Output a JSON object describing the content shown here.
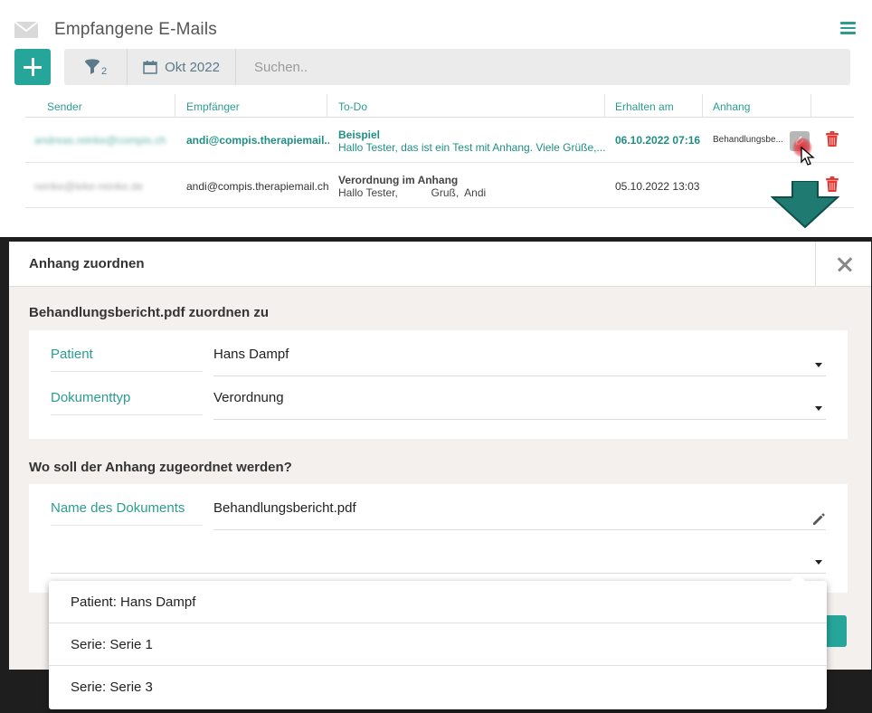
{
  "mail": {
    "title": "Empfangene E-Mails",
    "filter_count": "2",
    "date_filter": "Okt 2022",
    "search_placeholder": "Suchen..",
    "columns": [
      "Sender",
      "Empfänger",
      "To-Do",
      "Erhalten am",
      "Anhang"
    ],
    "rows": [
      {
        "sender": "andreas.reinke@compis.ch",
        "recipient": "andi@compis.therapiemail....",
        "todo_title": "Beispiel",
        "todo_body": "Hallo Tester,  das ist ein Test mit Anhang.  Viele Grüße,...",
        "received": "06.10.2022 07:16",
        "attachment": "Behandlungsbe...",
        "unread": true
      },
      {
        "sender": "reinke@leke-reinke.de",
        "recipient": "andi@compis.therapiemail.ch",
        "todo_title": "Verordnung im Anhang",
        "todo_body": "Hallo Tester,           Gruß,  Andi",
        "received": "05.10.2022 13:03",
        "attachment": "",
        "unread": false
      }
    ]
  },
  "modal": {
    "title": "Anhang zuordnen",
    "section1_title": "Behandlungsbericht.pdf zuordnen zu",
    "patient_label": "Patient",
    "patient_value": "Hans Dampf",
    "doctype_label": "Dokumenttyp",
    "doctype_value": "Verordnung",
    "section2_title": "Wo soll der Anhang zugeordnet werden?",
    "docname_label": "Name des Dokuments",
    "docname_value": "Behandlungsbericht.pdf",
    "target_value": ""
  },
  "dropdown": {
    "options": [
      "Patient: Hans Dampf",
      "Serie: Serie 1",
      "Serie: Serie 3"
    ]
  },
  "colors": {
    "accent": "#26a69a",
    "accent_text": "#2a9d8f",
    "danger": "#e53935",
    "arrow": "#1f7a72"
  }
}
